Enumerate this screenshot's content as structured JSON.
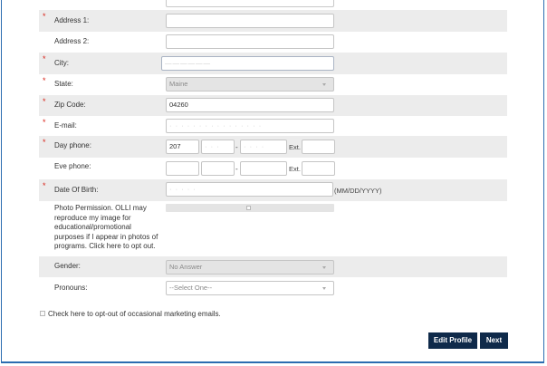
{
  "form": {
    "address1": {
      "label": "Address 1:",
      "required": "*",
      "value": ""
    },
    "address2": {
      "label": "Address 2:",
      "value": ""
    },
    "city": {
      "label": "City:",
      "required": "*",
      "value": "——————"
    },
    "state": {
      "label": "State:",
      "required": "*",
      "value": "Maine"
    },
    "zip": {
      "label": "Zip Code:",
      "required": "*",
      "value": "04260"
    },
    "email": {
      "label": "E-mail:",
      "required": "*",
      "value": "· · · · · ·  · · ·  ·  · · · ·  · ·"
    },
    "day_phone": {
      "label": "Day phone:",
      "required": "*",
      "area": "207",
      "prefix": "· · ·",
      "line": "· · · ·",
      "dash": "-",
      "ext_label": "Ext."
    },
    "eve_phone": {
      "label": "Eve phone:",
      "dash": "-",
      "ext_label": "Ext."
    },
    "dob": {
      "label": "Date Of Birth:",
      "required": "*",
      "value": "· · · · ·",
      "hint": "(MM/DD/YYYY)"
    },
    "photo_permission": {
      "lines": [
        "Photo Permission. OLLI may",
        "reproduce my image for",
        "educational/promotional",
        "purposes if I appear in photos of",
        "programs. Click here to opt out."
      ],
      "checked": false
    },
    "gender": {
      "label": "Gender:",
      "value": "No Answer"
    },
    "pronouns": {
      "label": "Pronouns:",
      "value": "--Select One--"
    },
    "marketing_opt_out": {
      "label": "Check here to opt-out of occasional marketing emails.",
      "checked": false
    }
  },
  "buttons": {
    "edit_profile": "Edit Profile",
    "next": "Next"
  },
  "colors": {
    "button_bg": "#0f2a4a",
    "required": "#d9261c",
    "frame": "#2b6cb0",
    "row_shade": "#ececec"
  }
}
